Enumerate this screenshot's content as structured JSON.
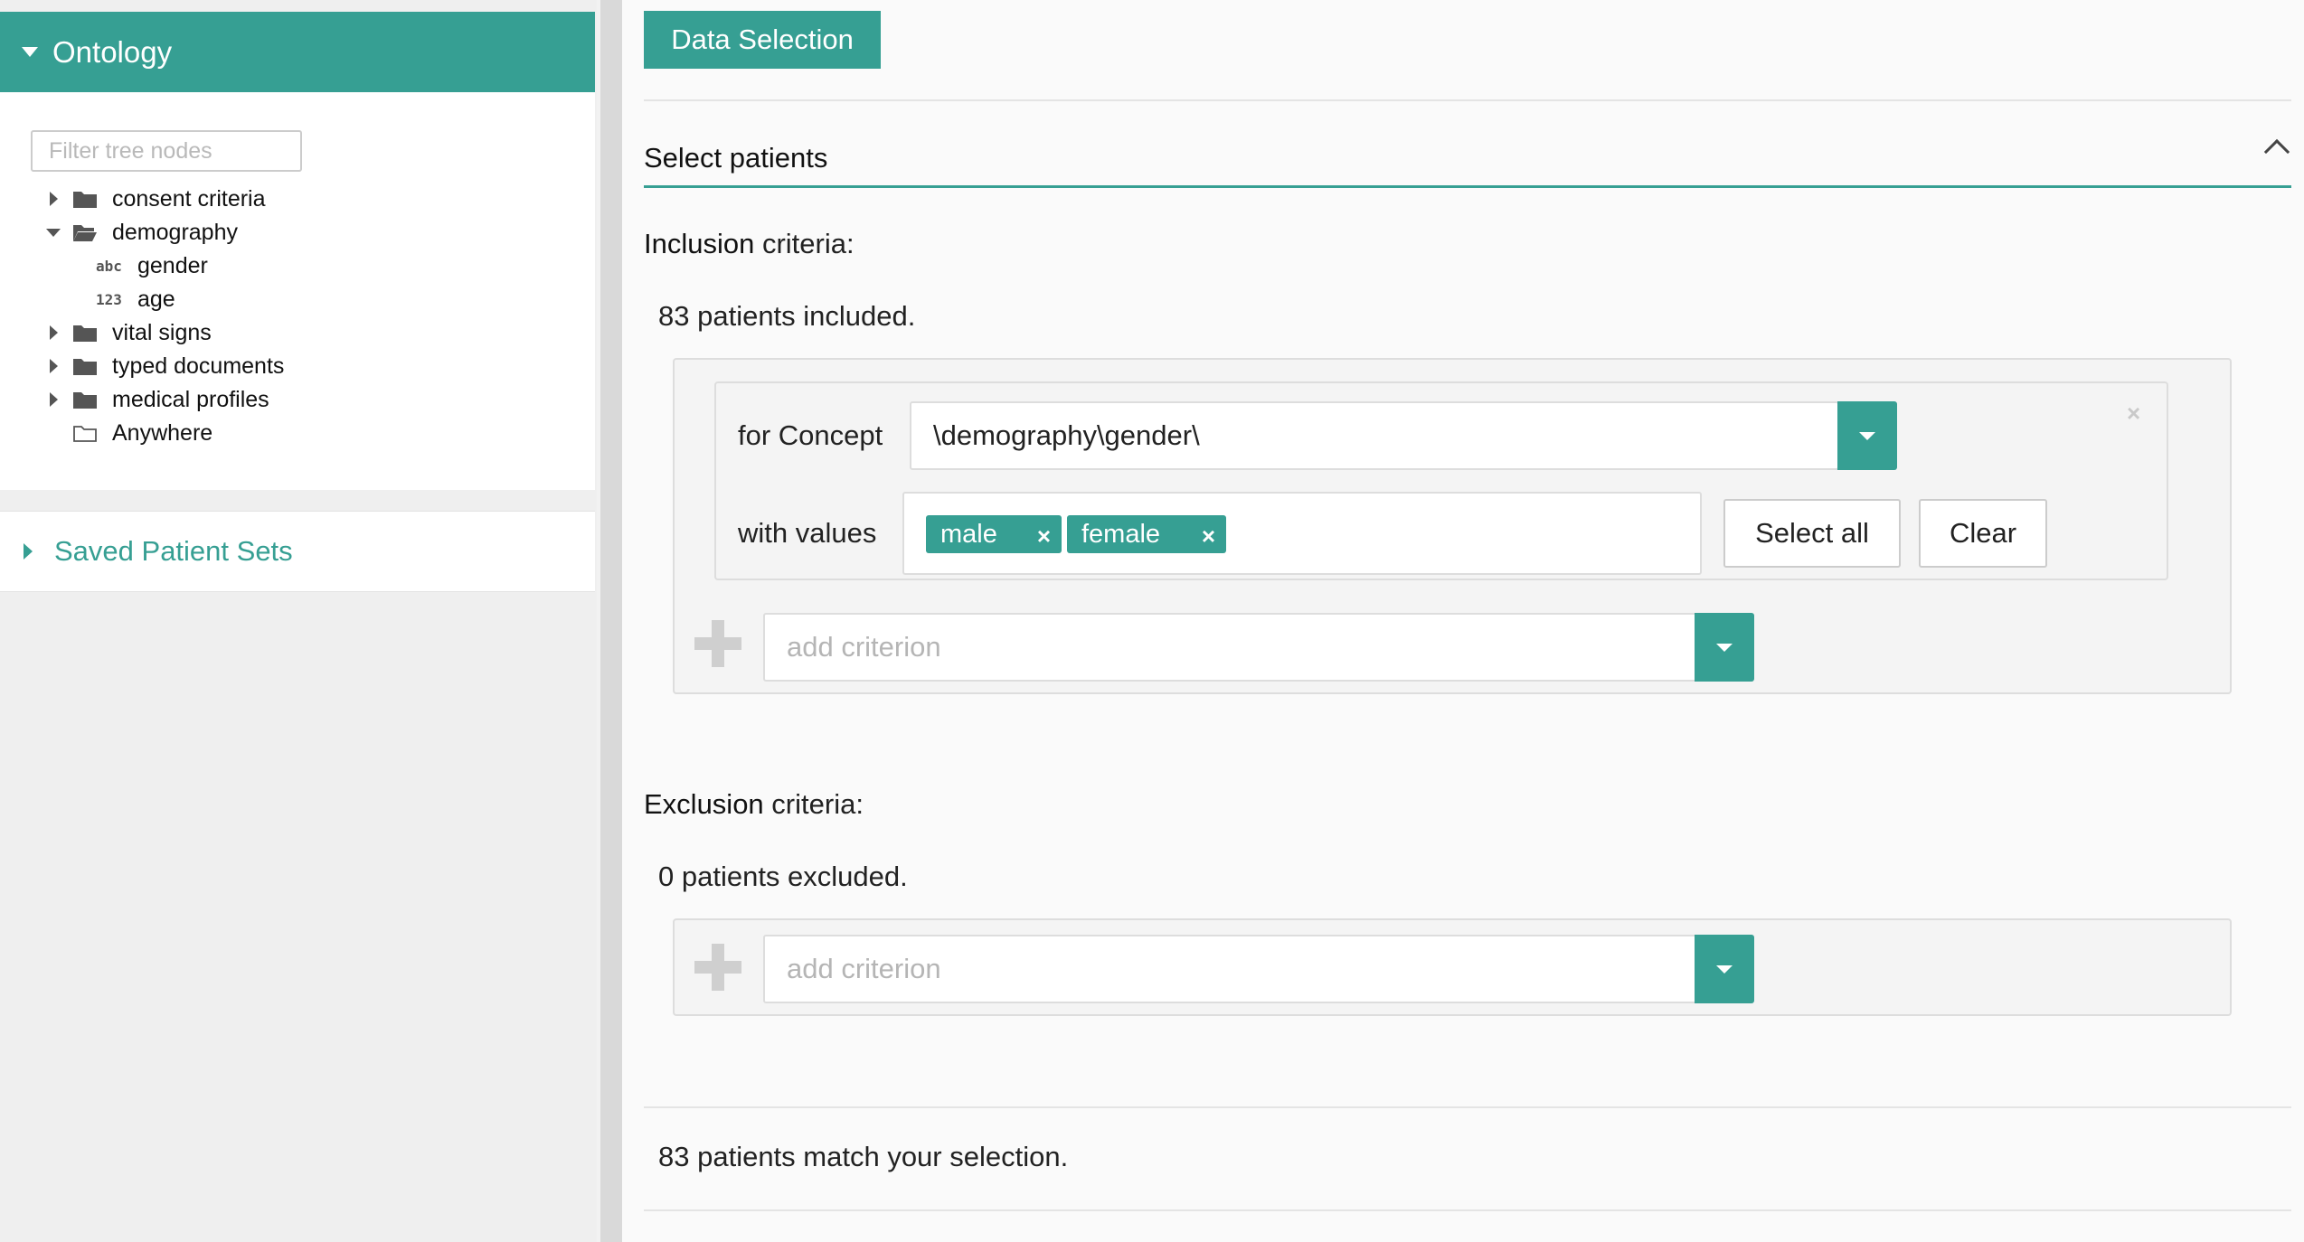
{
  "sidebar": {
    "ontology_title": "Ontology",
    "filter_placeholder": "Filter tree nodes",
    "tree": [
      {
        "label": "consent criteria",
        "kind": "folder",
        "state": "collapsed"
      },
      {
        "label": "demography",
        "kind": "folder",
        "state": "expanded"
      },
      {
        "label": "gender",
        "kind": "leaf",
        "type_tag": "abc"
      },
      {
        "label": "age",
        "kind": "leaf",
        "type_tag": "123"
      },
      {
        "label": "vital signs",
        "kind": "folder",
        "state": "collapsed"
      },
      {
        "label": "typed documents",
        "kind": "folder",
        "state": "collapsed"
      },
      {
        "label": "medical profiles",
        "kind": "folder",
        "state": "collapsed"
      },
      {
        "label": "Anywhere",
        "kind": "folder-outline",
        "state": "none"
      }
    ],
    "saved_sets_label": "Saved Patient Sets"
  },
  "main": {
    "tab_label": "Data Selection",
    "section_title": "Select patients",
    "inclusion": {
      "title_bold": "Inclusion",
      "title_rest": " criteria:",
      "count_text": "83 patients included.",
      "concept_label": "for Concept",
      "concept_value": "\\demography\\gender\\",
      "values_label": "with values",
      "tags": [
        "male",
        "female"
      ],
      "select_all_label": "Select all",
      "clear_label": "Clear",
      "add_placeholder": "add criterion"
    },
    "exclusion": {
      "title_bold": "Exclusion",
      "title_rest": " criteria:",
      "count_text": "0 patients excluded.",
      "add_placeholder": "add criterion"
    },
    "match_text": "83 patients match your selection."
  },
  "colors": {
    "accent": "#369f93",
    "panel_bg": "#f4f4f4",
    "sidebar_bg": "#efefef"
  },
  "icons": {
    "tag_remove": "×",
    "criterion_remove": "×"
  }
}
